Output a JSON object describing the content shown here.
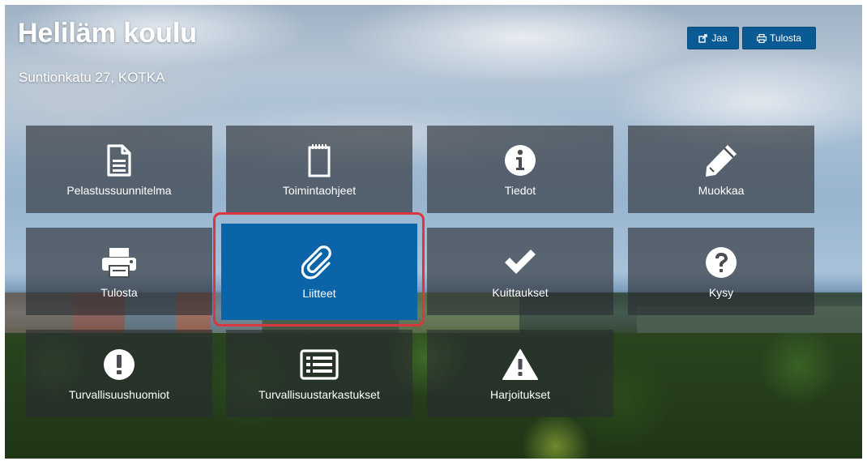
{
  "header": {
    "title": "Heliläm koulu",
    "subtitle": "Suntionkatu 27, KOTKA"
  },
  "toolbar": {
    "share_label": "Jaa",
    "print_label": "Tulosta"
  },
  "tiles": [
    {
      "label": "Pelastussuunnitelma",
      "icon": "document-icon"
    },
    {
      "label": "Toimintaohjeet",
      "icon": "notepad-icon"
    },
    {
      "label": "Tiedot",
      "icon": "info-icon"
    },
    {
      "label": "Muokkaa",
      "icon": "pencil-icon"
    },
    {
      "label": "Tulosta",
      "icon": "printer-icon"
    },
    {
      "label": "Liitteet",
      "icon": "paperclip-icon",
      "selected": true
    },
    {
      "label": "Kuittaukset",
      "icon": "checkmark-icon"
    },
    {
      "label": "Kysy",
      "icon": "question-icon"
    },
    {
      "label": "Turvallisuushuomiot",
      "icon": "exclamation-icon"
    },
    {
      "label": "Turvallisuustarkastukset",
      "icon": "list-icon"
    },
    {
      "label": "Harjoitukset",
      "icon": "warning-icon"
    }
  ],
  "colors": {
    "accent": "#0c64a8",
    "button": "#0a5a94",
    "highlight": "#d9363e",
    "tile_bg": "rgba(40,44,48,0.62)"
  }
}
